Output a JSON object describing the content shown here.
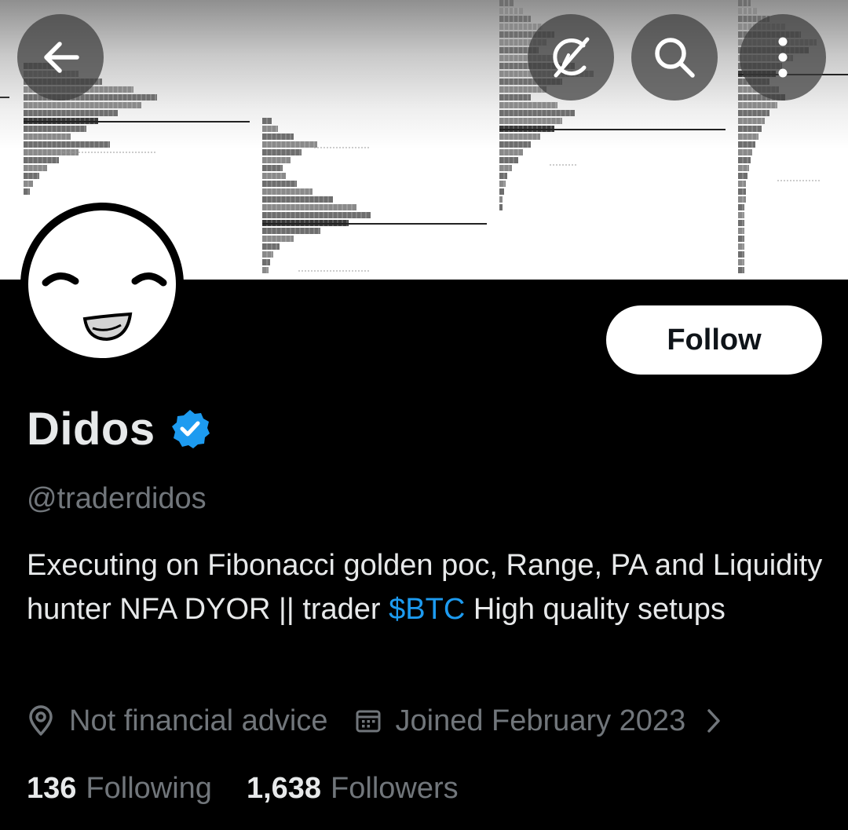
{
  "header": {
    "back_icon": "arrow-left-icon",
    "grok_icon": "grok-icon",
    "search_icon": "search-icon",
    "more_icon": "more-vertical-icon"
  },
  "profile": {
    "display_name": "Didos",
    "verified": true,
    "handle": "@traderdidos",
    "follow_label": "Follow",
    "bio": {
      "part1": "Executing on Fibonacci golden poc, Range, PA and Liquidity hunter NFA DYOR || trader ",
      "cashtag": "$BTC",
      "part2": " High quality setups"
    },
    "location": "Not financial advice",
    "joined": "Joined February 2023",
    "following_count": "136",
    "following_label": "Following",
    "followers_count": "1,638",
    "followers_label": "Followers"
  },
  "colors": {
    "background": "#000000",
    "text_primary": "#e7e9ea",
    "text_secondary": "#71767b",
    "accent": "#1d9bf0",
    "verified_badge": "#1d9bf0"
  }
}
